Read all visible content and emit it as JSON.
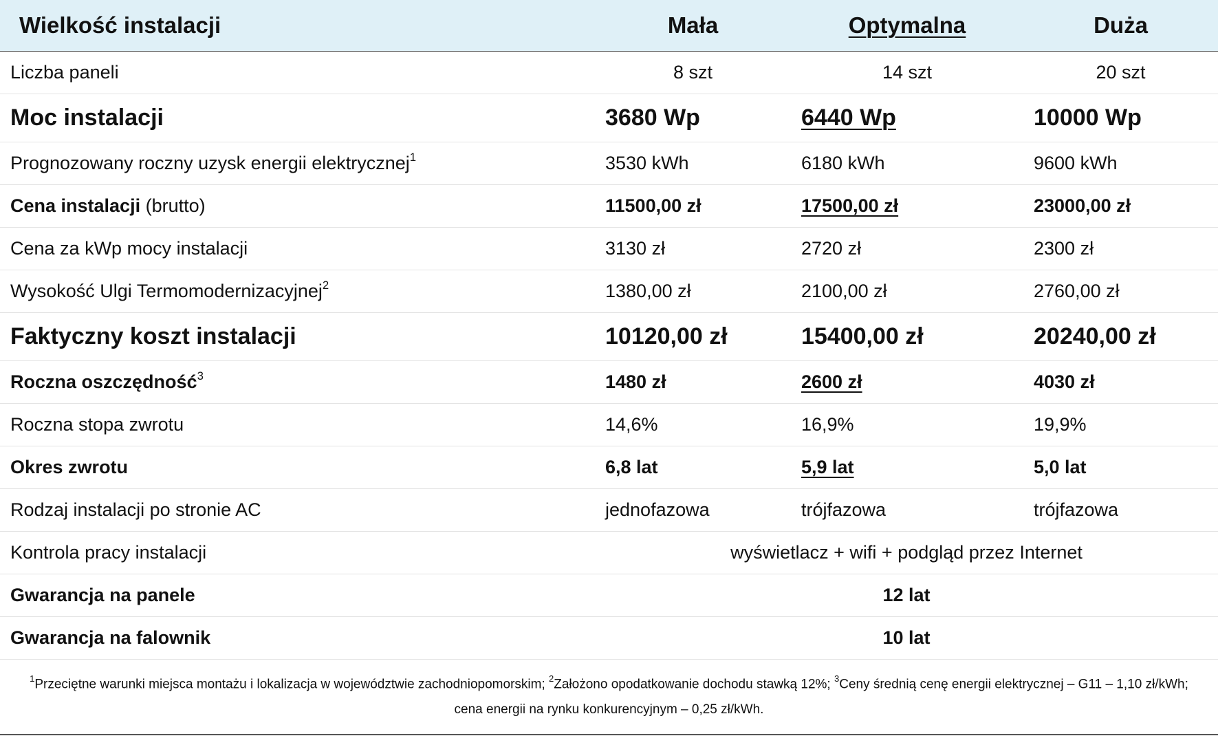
{
  "header": {
    "title": "Wielkość instalacji",
    "columns": [
      "Mała",
      "Optymalna",
      "Duża"
    ]
  },
  "rows": {
    "panels": {
      "label": "Liczba paneli",
      "values": [
        "8 szt",
        "14 szt",
        "20 szt"
      ]
    },
    "power": {
      "label": "Moc instalacji",
      "values": [
        "3680 Wp",
        "6440 Wp",
        "10000 Wp"
      ]
    },
    "yield": {
      "label": "Prognozowany roczny uzysk energii elektrycznej",
      "sup": "1",
      "values": [
        "3530 kWh",
        "6180 kWh",
        "9600 kWh"
      ]
    },
    "price": {
      "label": "Cena instalacji",
      "label_suffix": "(brutto)",
      "values": [
        "11500,00 zł",
        "17500,00 zł",
        "23000,00 zł"
      ]
    },
    "price_per_kwp": {
      "label": "Cena za kWp mocy instalacji",
      "values": [
        "3130 zł",
        "2720 zł",
        "2300 zł"
      ]
    },
    "relief": {
      "label": "Wysokość Ulgi Termomodernizacyjnej",
      "sup": "2",
      "values": [
        "1380,00 zł",
        "2100,00 zł",
        "2760,00 zł"
      ]
    },
    "actual_cost": {
      "label": "Faktyczny koszt instalacji",
      "values": [
        "10120,00 zł",
        "15400,00 zł",
        "20240,00 zł"
      ]
    },
    "savings": {
      "label": "Roczna oszczędność",
      "sup": "3",
      "values": [
        "1480 zł",
        "2600 zł",
        "4030 zł"
      ]
    },
    "return_rate": {
      "label": "Roczna stopa zwrotu",
      "values": [
        "14,6%",
        "16,9%",
        "19,9%"
      ]
    },
    "payback": {
      "label": "Okres zwrotu",
      "values": [
        "6,8 lat",
        "5,9 lat",
        "5,0 lat"
      ]
    },
    "ac_type": {
      "label": "Rodzaj instalacji po stronie AC",
      "values": [
        "jednofazowa",
        "trójfazowa",
        "trójfazowa"
      ]
    },
    "monitoring": {
      "label": "Kontrola pracy instalacji",
      "value": "wyświetlacz + wifi + podgląd przez Internet"
    },
    "panel_warranty": {
      "label": "Gwarancja na panele",
      "value": "12 lat"
    },
    "inverter_warranty": {
      "label": "Gwarancja na falownik",
      "value": "10 lat"
    }
  },
  "footnotes": {
    "n1": "1",
    "t1": "Przeciętne warunki miejsca montażu i lokalizacja w województwie zachodniopomorskim; ",
    "n2": "2",
    "t2": "Założono opodatkowanie dochodu stawką 12%; ",
    "n3": "3",
    "t3": "Ceny średnią cenę energii elektrycznej – G11 – 1,10 zł/kWh; cena energii na rynku konkurencyjnym – 0,25 zł/kWh."
  }
}
